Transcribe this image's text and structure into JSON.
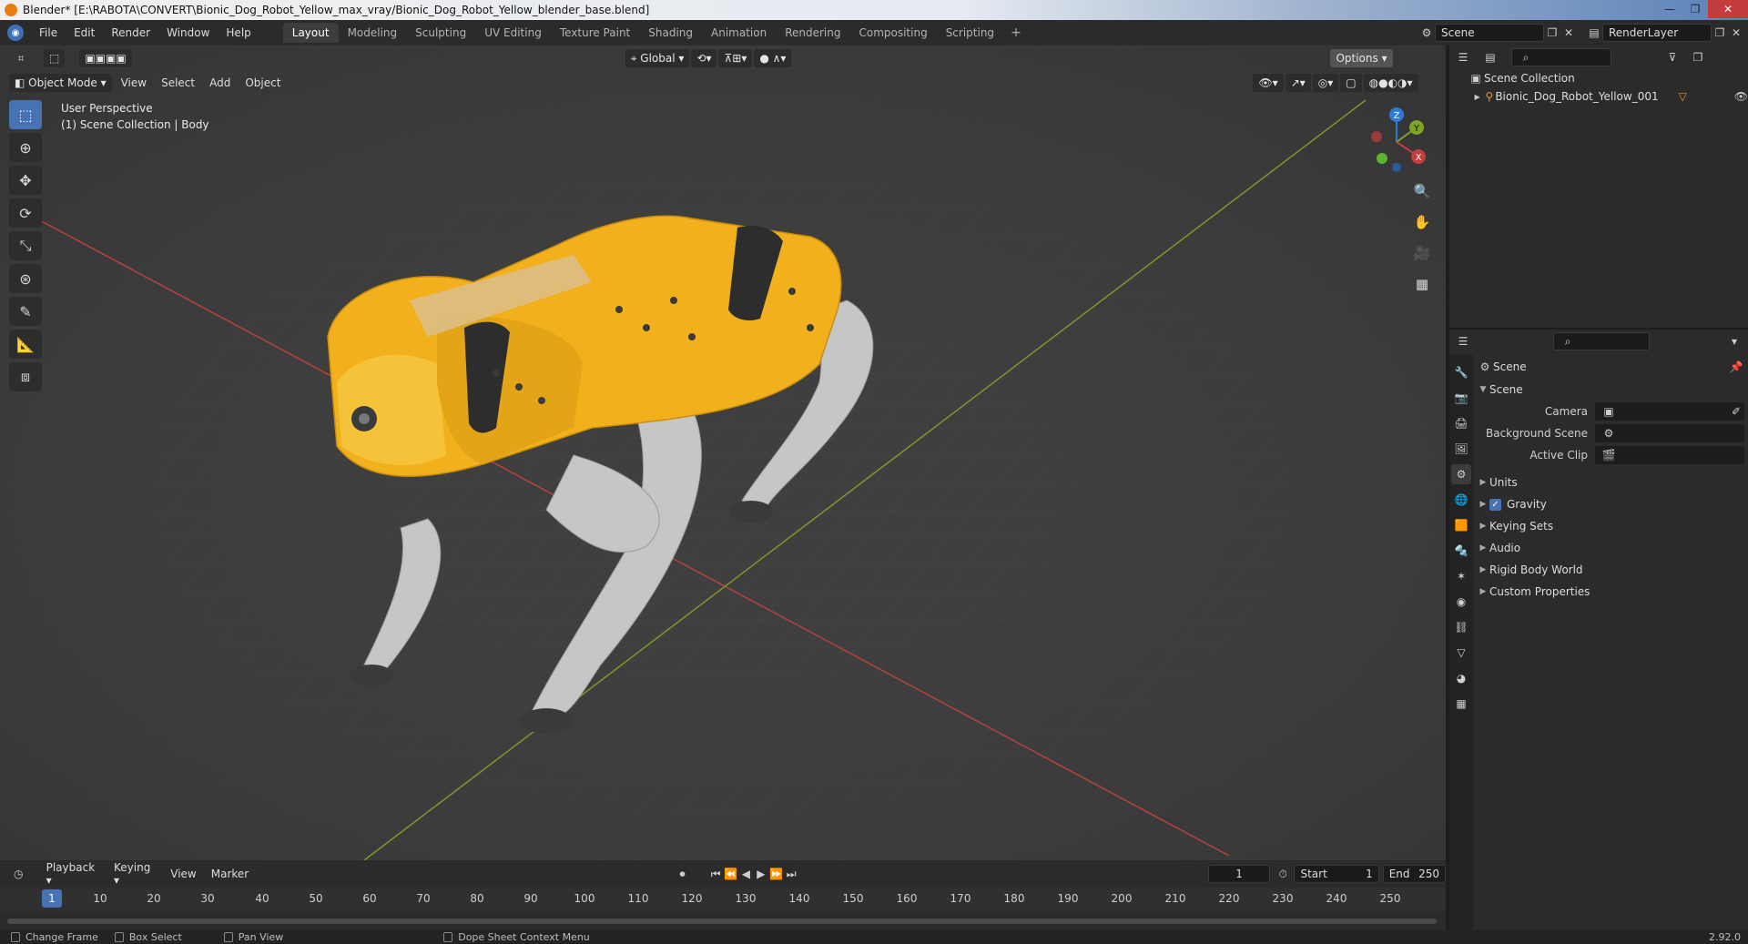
{
  "window": {
    "title": "Blender* [E:\\RABOTA\\CONVERT\\Bionic_Dog_Robot_Yellow_max_vray/Bionic_Dog_Robot_Yellow_blender_base.blend]"
  },
  "menu": [
    "File",
    "Edit",
    "Render",
    "Window",
    "Help"
  ],
  "workspaces": [
    "Layout",
    "Modeling",
    "Sculpting",
    "UV Editing",
    "Texture Paint",
    "Shading",
    "Animation",
    "Rendering",
    "Compositing",
    "Scripting"
  ],
  "active_workspace": "Layout",
  "top_right": {
    "scene": "Scene",
    "render_layer": "RenderLayer"
  },
  "viewport": {
    "mode": "Object Mode",
    "menus": [
      "View",
      "Select",
      "Add",
      "Object"
    ],
    "transform_orientation": "Global",
    "options_label": "Options",
    "overlay_line1": "User Perspective",
    "overlay_line2": "(1) Scene Collection | Body",
    "gizmo": {
      "z": "Z",
      "y": "Y",
      "x": "X"
    }
  },
  "outliner": {
    "root": "Scene Collection",
    "items": [
      "Bionic_Dog_Robot_Yellow_001"
    ]
  },
  "properties": {
    "header": "Scene",
    "section": "Scene",
    "fields": [
      {
        "label": "Camera",
        "value": ""
      },
      {
        "label": "Background Scene",
        "value": ""
      },
      {
        "label": "Active Clip",
        "value": ""
      }
    ],
    "panels": [
      "Units",
      "Gravity",
      "Keying Sets",
      "Audio",
      "Rigid Body World",
      "Custom Properties"
    ]
  },
  "timeline": {
    "menus": [
      "Playback",
      "Keying",
      "View",
      "Marker"
    ],
    "current_frame": "1",
    "start_label": "Start",
    "start": "1",
    "end_label": "End",
    "end": "250",
    "ruler_cursor": "1",
    "ticks": [
      "10",
      "20",
      "30",
      "40",
      "50",
      "60",
      "70",
      "80",
      "90",
      "100",
      "110",
      "120",
      "130",
      "140",
      "150",
      "160",
      "170",
      "180",
      "190",
      "200",
      "210",
      "220",
      "230",
      "240",
      "250"
    ]
  },
  "status": {
    "items": [
      "Change Frame",
      "Box Select",
      "Pan View",
      "Dope Sheet Context Menu"
    ],
    "version": "2.92.0"
  },
  "colors": {
    "accent": "#4772b3",
    "robot_body": "#f2b11c",
    "robot_legs": "#c9c9c9",
    "x_axis": "#c43c3c",
    "y_axis": "#7fa324"
  }
}
